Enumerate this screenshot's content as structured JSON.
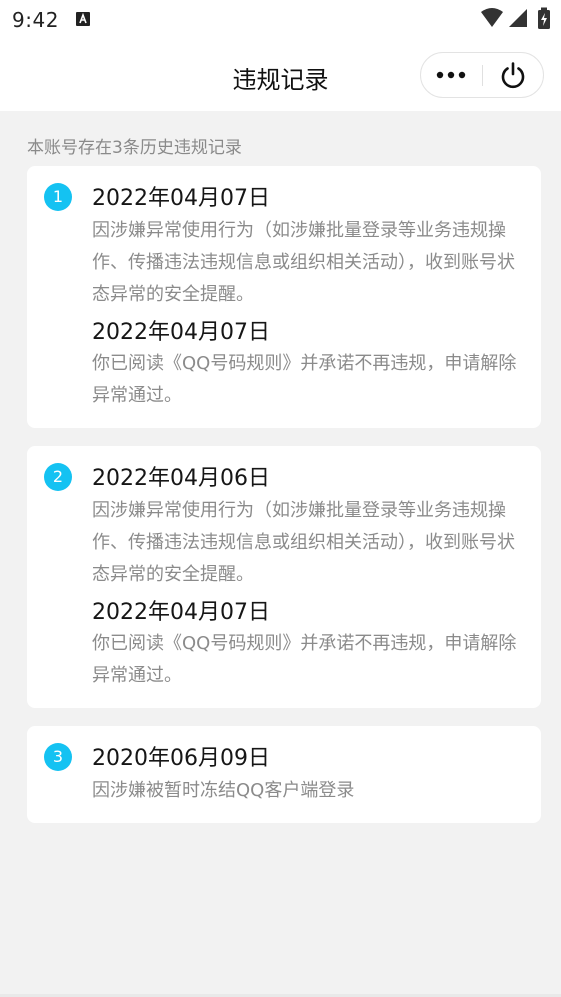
{
  "status_bar": {
    "time": "9:42"
  },
  "header": {
    "title": "违规记录"
  },
  "summary": "本账号存在3条历史违规记录",
  "records": [
    {
      "index": "1",
      "date": "2022年04月07日",
      "description": "因涉嫌异常使用行为（如涉嫌批量登录等业务违规操作、传播违法违规信息或组织相关活动），收到账号状态异常的安全提醒。",
      "resolve_date": "2022年04月07日",
      "resolve_text": "你已阅读《QQ号码规则》并承诺不再违规，申请解除异常通过。"
    },
    {
      "index": "2",
      "date": "2022年04月06日",
      "description": "因涉嫌异常使用行为（如涉嫌批量登录等业务违规操作、传播违法违规信息或组织相关活动），收到账号状态异常的安全提醒。",
      "resolve_date": "2022年04月07日",
      "resolve_text": "你已阅读《QQ号码规则》并承诺不再违规，申请解除异常通过。"
    },
    {
      "index": "3",
      "date": "2020年06月09日",
      "description": "因涉嫌被暂时冻结QQ客户端登录"
    }
  ],
  "colors": {
    "badge": "#14c2f2",
    "background": "#f2f2f2",
    "card": "#ffffff",
    "secondary_text": "#8b8b8b"
  },
  "icons": {
    "status_left": "a-notification-icon",
    "status_right": [
      "wifi-icon",
      "signal-icon",
      "battery-charging-icon"
    ],
    "capsule": [
      "more-icon",
      "power-icon"
    ]
  }
}
